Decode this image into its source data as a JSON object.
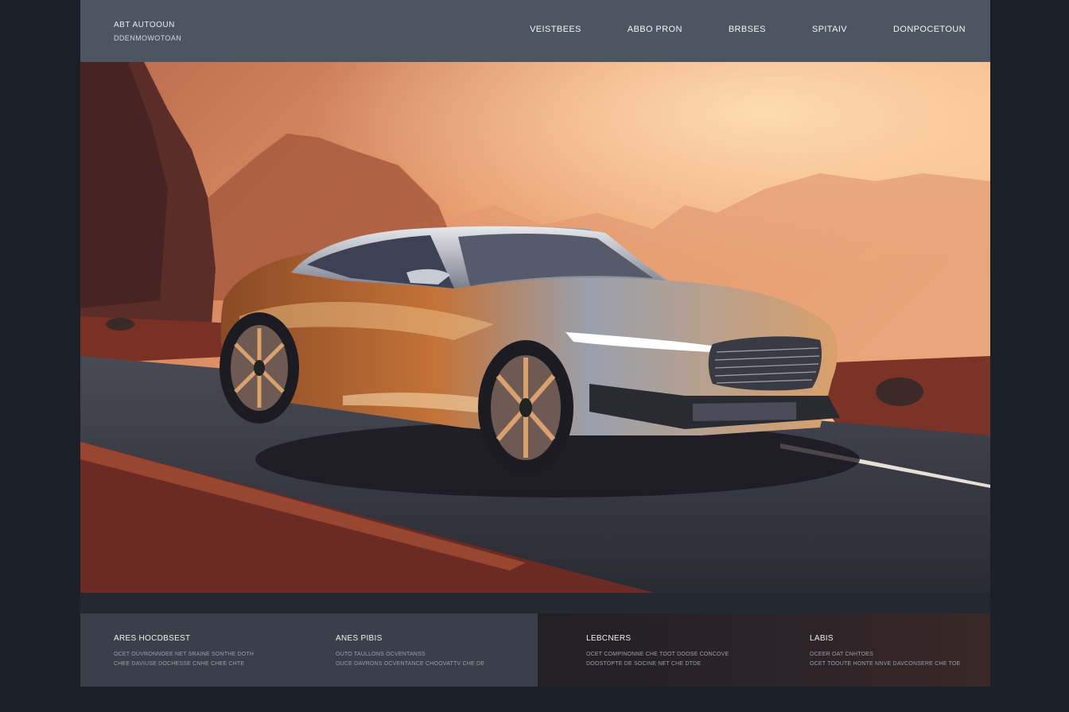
{
  "brand": {
    "line1": "ABT AUTOOUN",
    "line2": "DDENMOWOTOAN"
  },
  "nav": [
    {
      "label": "VEISTBEES"
    },
    {
      "label": "ABBO PRON"
    },
    {
      "label": "BRBSES"
    },
    {
      "label": "SPITAIV"
    },
    {
      "label": "DONPOCETOUN"
    }
  ],
  "hero": {
    "subject": "futuristic copper-silver sports car on mountain road at sunset"
  },
  "features": [
    {
      "title": "ARES HOCDBSEST",
      "lines": [
        "OCET OUVRONNOEE NET SRAINE SONTHE DOTH",
        "CHEE DAVIUSE DOCHESSE CNHE CHEE CHTE"
      ]
    },
    {
      "title": "ANES PIBIS",
      "lines": [
        "OUTO TAULLONS OCVENTANSS",
        "OUCE DAVRONS OCVENTANCE CHOOVATTV CHE DE"
      ]
    },
    {
      "title": "LEBCNERS",
      "lines": [
        "OCET COMPINONNE CHE TOOT DOOSE CONCOVE",
        "DOOSTOPTE DE SOCINE NET CHE DTDE"
      ]
    },
    {
      "title": "LABIS",
      "lines": [
        "OCEER OAT CNHTOES",
        "OCET TOOUTE HONTE NNVE DAVCONSERE CHE TOE"
      ]
    }
  ],
  "colors": {
    "header": "#4d5660",
    "page": "#1b1f27",
    "panel_left": "#3a4049",
    "panel_right": "#2a2227"
  }
}
